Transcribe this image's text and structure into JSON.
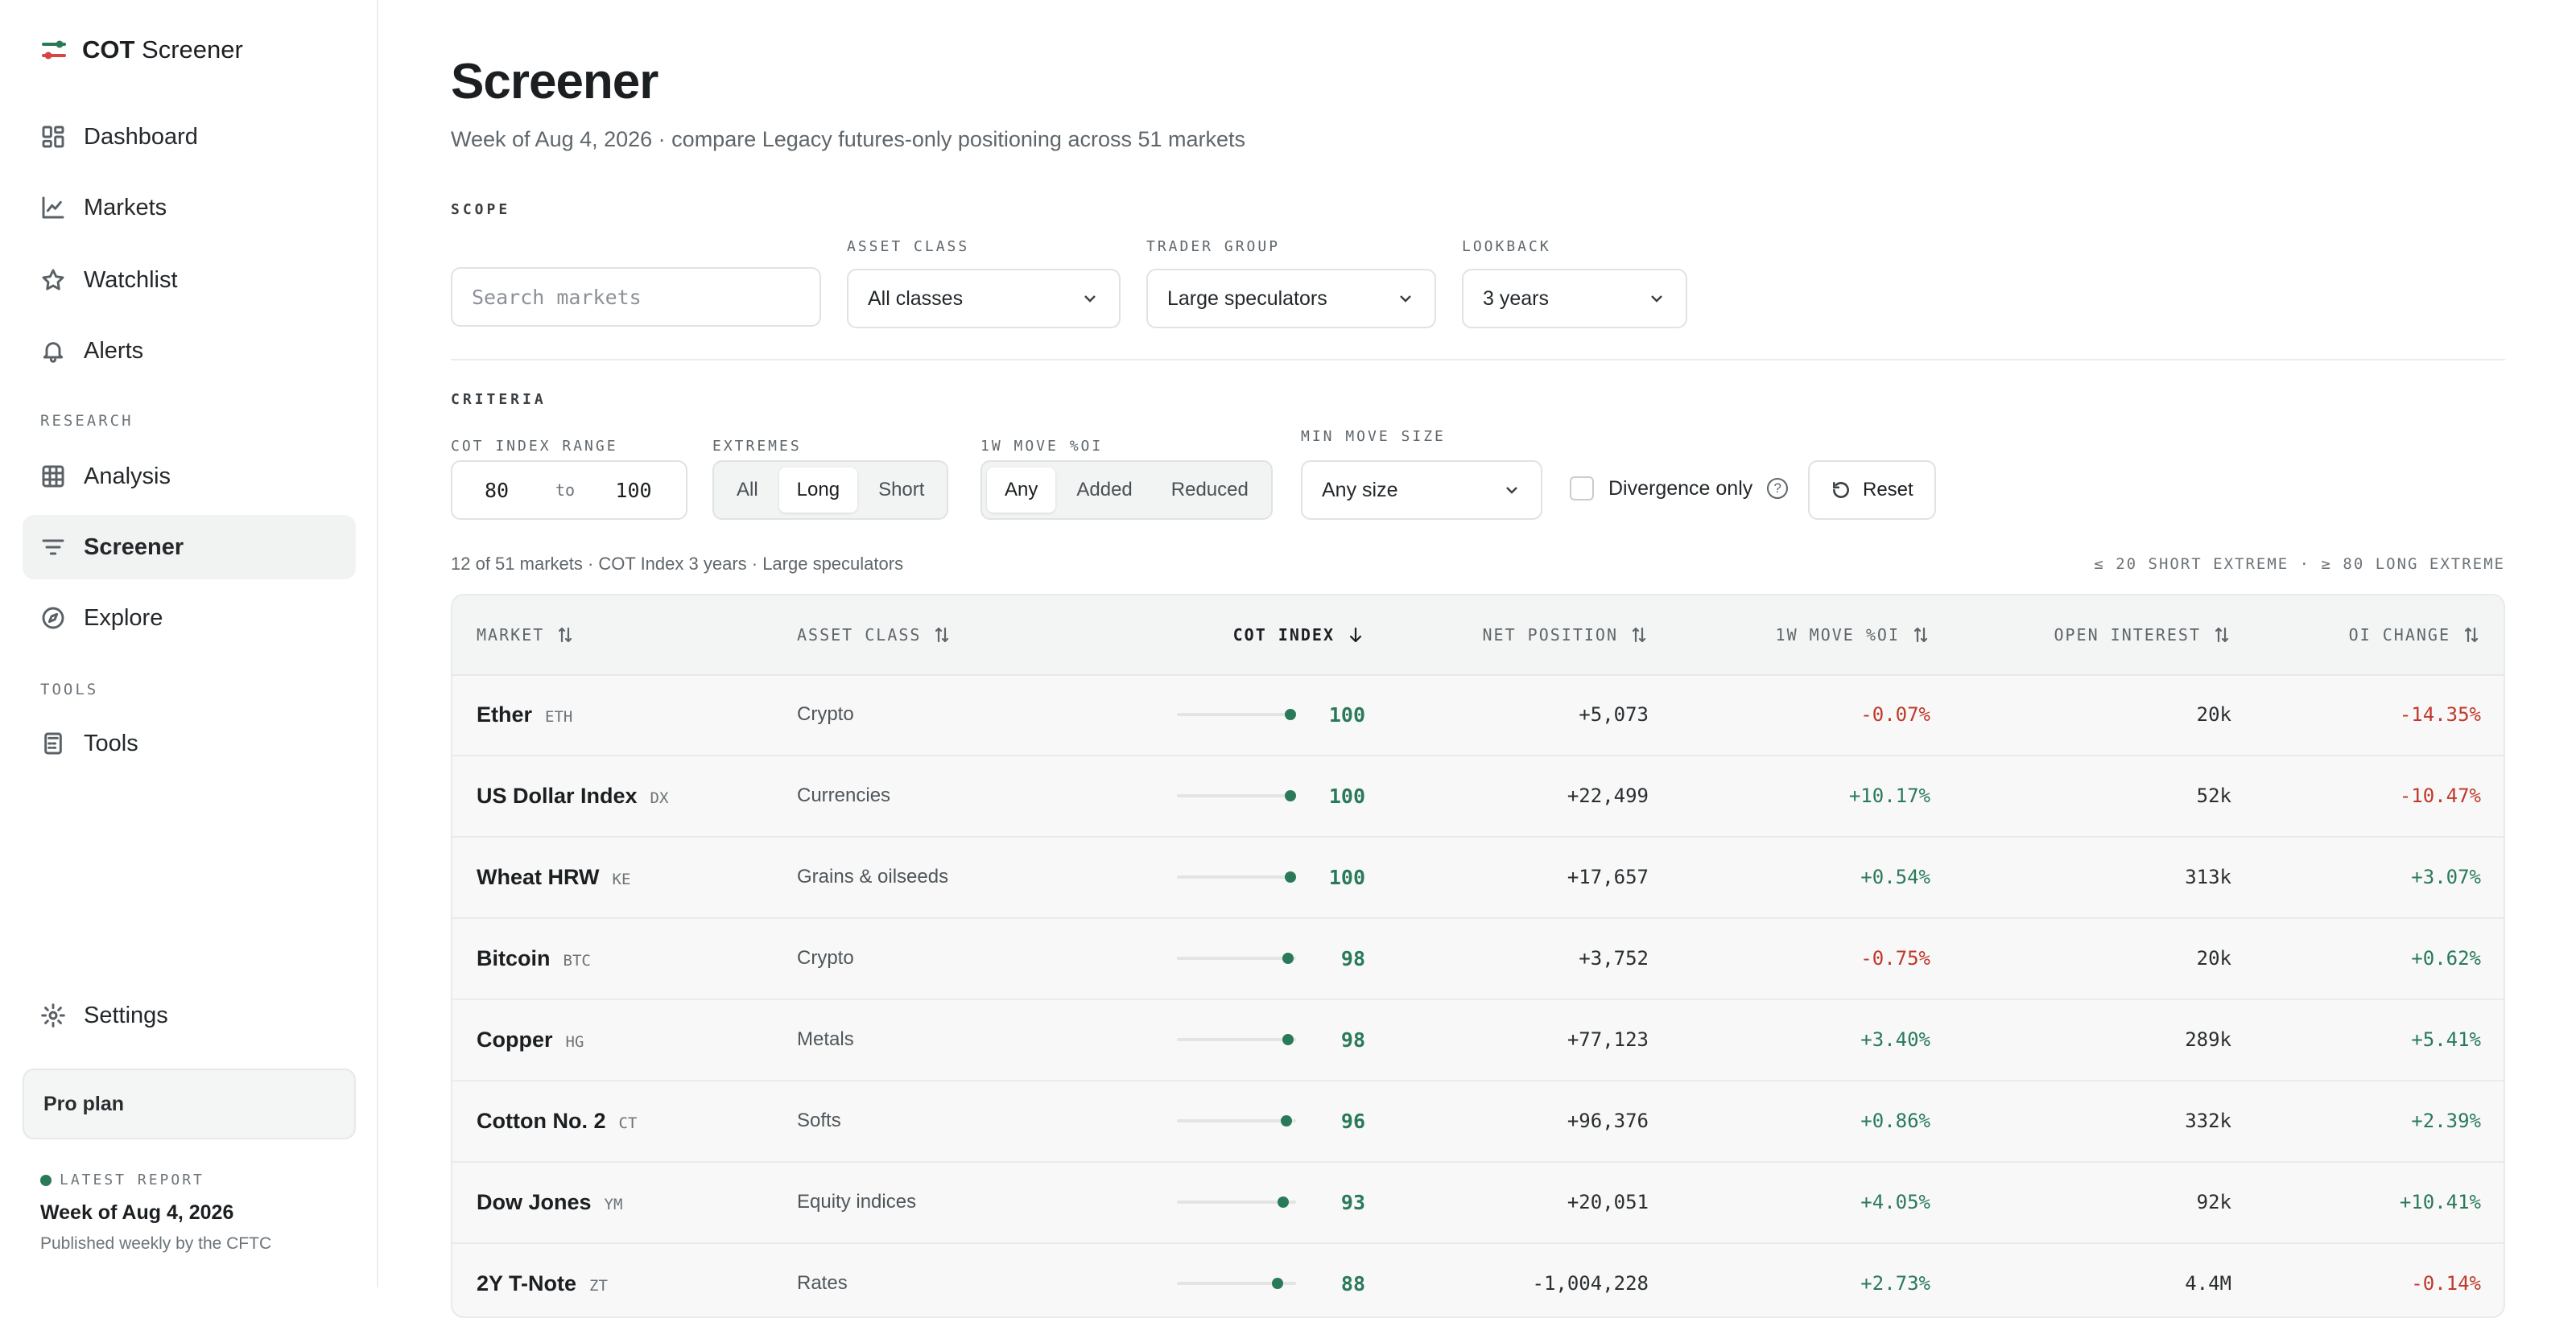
{
  "brand": {
    "bold": "COT",
    "rest": " Screener"
  },
  "nav": {
    "main": [
      {
        "label": "Dashboard",
        "icon": "dashboard-icon"
      },
      {
        "label": "Markets",
        "icon": "chart-line-icon"
      },
      {
        "label": "Watchlist",
        "icon": "star-icon"
      },
      {
        "label": "Alerts",
        "icon": "bell-icon"
      }
    ],
    "research_heading": "RESEARCH",
    "research": [
      {
        "label": "Analysis",
        "icon": "grid-icon"
      },
      {
        "label": "Screener",
        "icon": "filter-icon",
        "active": true
      },
      {
        "label": "Explore",
        "icon": "compass-icon"
      }
    ],
    "tools_heading": "TOOLS",
    "tools": [
      {
        "label": "Tools",
        "icon": "calculator-icon"
      }
    ],
    "settings": "Settings"
  },
  "plan": "Pro plan",
  "latest": {
    "label": "LATEST REPORT",
    "week": "Week of Aug 4, 2026",
    "published": "Published weekly by the CFTC"
  },
  "page": {
    "title": "Screener",
    "subtitle": "Week of Aug 4, 2026 · compare Legacy futures-only positioning across 51 markets"
  },
  "scope": {
    "heading": "SCOPE",
    "search_placeholder": "Search markets",
    "asset_class": {
      "label": "ASSET CLASS",
      "value": "All classes"
    },
    "trader_group": {
      "label": "TRADER GROUP",
      "value": "Large speculators"
    },
    "lookback": {
      "label": "LOOKBACK",
      "value": "3 years"
    }
  },
  "criteria": {
    "heading": "CRITERIA",
    "range": {
      "label": "COT INDEX RANGE",
      "min": "80",
      "to": "to",
      "max": "100"
    },
    "extremes": {
      "label": "EXTREMES",
      "options": [
        "All",
        "Long",
        "Short"
      ],
      "selected": "Long"
    },
    "move": {
      "label": "1W MOVE %OI",
      "options": [
        "Any",
        "Added",
        "Reduced"
      ],
      "selected": "Any"
    },
    "min_move": {
      "label": "MIN MOVE SIZE",
      "value": "Any size"
    },
    "divergence": "Divergence only",
    "reset": "Reset"
  },
  "results": {
    "summary": "12 of 51 markets · COT Index 3 years · Large speculators",
    "legend": "≤ 20 SHORT EXTREME · ≥ 80 LONG EXTREME"
  },
  "table": {
    "columns": {
      "market": "MARKET",
      "asset": "ASSET CLASS",
      "cot": "COT INDEX",
      "net": "NET POSITION",
      "move": "1W MOVE %OI",
      "oi": "OPEN INTEREST",
      "oichg": "OI CHANGE"
    },
    "rows": [
      {
        "name": "Ether",
        "sym": "ETH",
        "asset": "Crypto",
        "cot": 100,
        "net": "+5,073",
        "move": "-0.07%",
        "oi": "20k",
        "oichg": "-14.35%"
      },
      {
        "name": "US Dollar Index",
        "sym": "DX",
        "asset": "Currencies",
        "cot": 100,
        "net": "+22,499",
        "move": "+10.17%",
        "oi": "52k",
        "oichg": "-10.47%"
      },
      {
        "name": "Wheat HRW",
        "sym": "KE",
        "asset": "Grains & oilseeds",
        "cot": 100,
        "net": "+17,657",
        "move": "+0.54%",
        "oi": "313k",
        "oichg": "+3.07%"
      },
      {
        "name": "Bitcoin",
        "sym": "BTC",
        "asset": "Crypto",
        "cot": 98,
        "net": "+3,752",
        "move": "-0.75%",
        "oi": "20k",
        "oichg": "+0.62%"
      },
      {
        "name": "Copper",
        "sym": "HG",
        "asset": "Metals",
        "cot": 98,
        "net": "+77,123",
        "move": "+3.40%",
        "oi": "289k",
        "oichg": "+5.41%"
      },
      {
        "name": "Cotton No. 2",
        "sym": "CT",
        "asset": "Softs",
        "cot": 96,
        "net": "+96,376",
        "move": "+0.86%",
        "oi": "332k",
        "oichg": "+2.39%"
      },
      {
        "name": "Dow Jones",
        "sym": "YM",
        "asset": "Equity indices",
        "cot": 93,
        "net": "+20,051",
        "move": "+4.05%",
        "oi": "92k",
        "oichg": "+10.41%"
      },
      {
        "name": "2Y T-Note",
        "sym": "ZT",
        "asset": "Rates",
        "cot": 88,
        "net": "-1,004,228",
        "move": "+2.73%",
        "oi": "4.4M",
        "oichg": "-0.14%"
      }
    ]
  },
  "colors": {
    "accent": "#2a7a5a",
    "negative": "#c0392b",
    "brand_red": "#d64545"
  }
}
